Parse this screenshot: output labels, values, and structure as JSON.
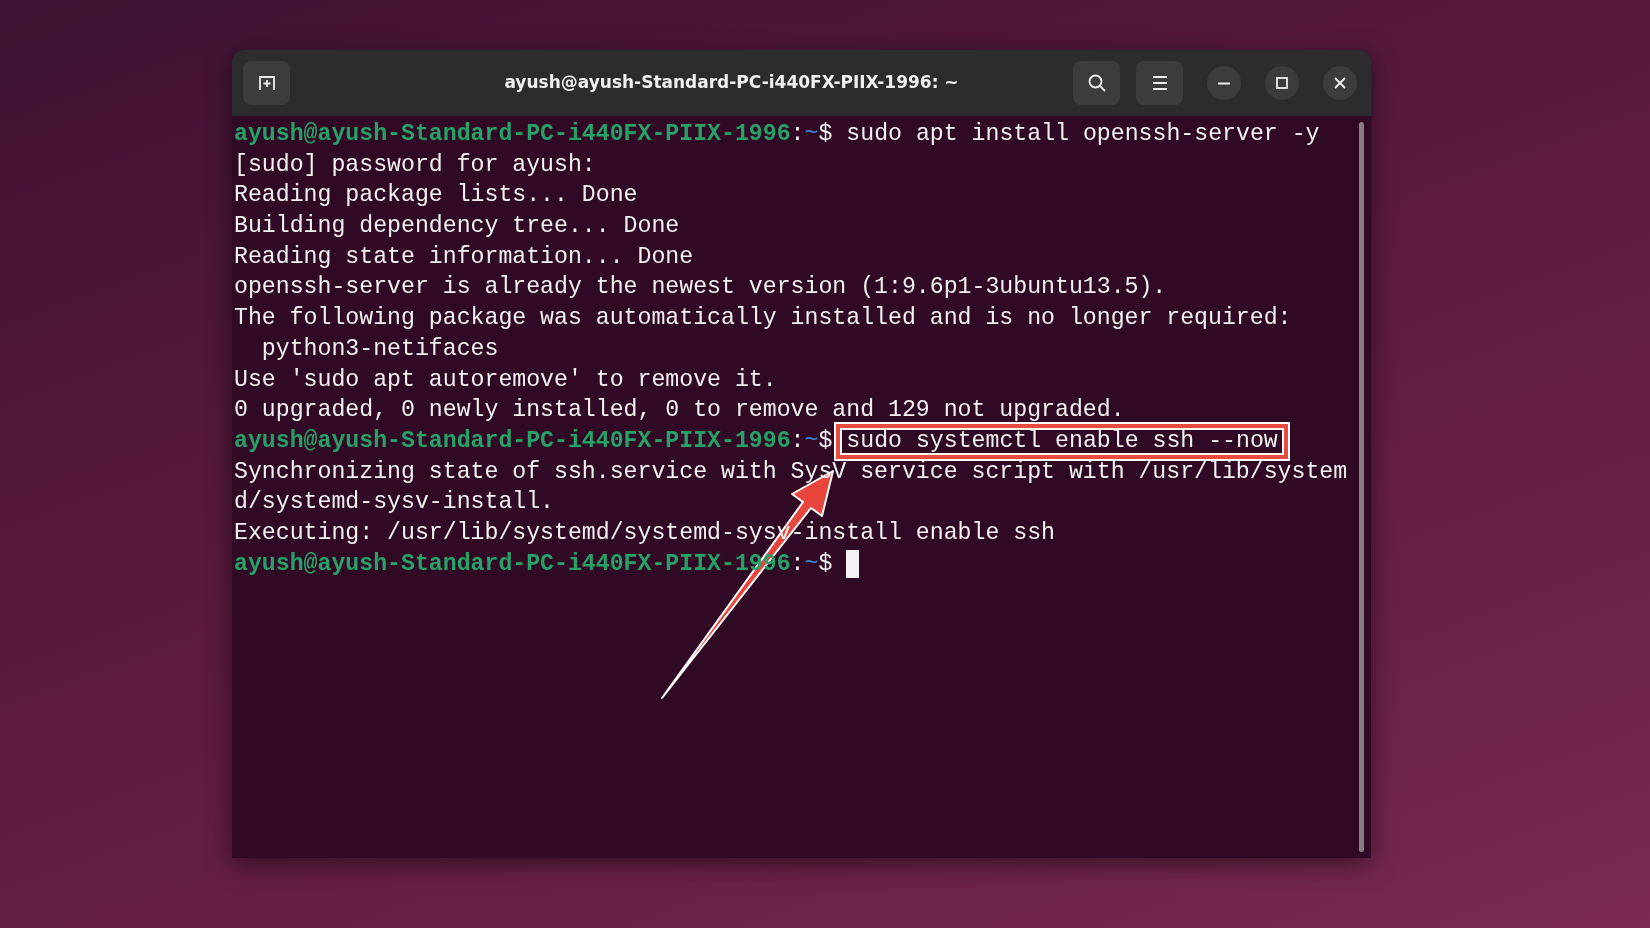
{
  "window": {
    "title": "ayush@ayush-Standard-PC-i440FX-PIIX-1996: ~"
  },
  "terminal": {
    "lines": [
      {
        "kind": "prompt",
        "user": "ayush@ayush-Standard-PC-i440FX-PIIX-1996",
        "separator": ":",
        "path": "~",
        "symbol": "$",
        "command": "sudo apt install openssh-server -y",
        "highlighted": false,
        "cursor": false
      },
      {
        "kind": "output",
        "text": "[sudo] password for ayush:"
      },
      {
        "kind": "output",
        "text": "Reading package lists... Done"
      },
      {
        "kind": "output",
        "text": "Building dependency tree... Done"
      },
      {
        "kind": "output",
        "text": "Reading state information... Done"
      },
      {
        "kind": "output",
        "text": "openssh-server is already the newest version (1:9.6p1-3ubuntu13.5)."
      },
      {
        "kind": "output",
        "text": "The following package was automatically installed and is no longer required:"
      },
      {
        "kind": "output",
        "text": "  python3-netifaces"
      },
      {
        "kind": "output",
        "text": "Use 'sudo apt autoremove' to remove it."
      },
      {
        "kind": "output",
        "text": "0 upgraded, 0 newly installed, 0 to remove and 129 not upgraded."
      },
      {
        "kind": "prompt",
        "user": "ayush@ayush-Standard-PC-i440FX-PIIX-1996",
        "separator": ":",
        "path": "~",
        "symbol": "$",
        "command": "sudo systemctl enable ssh --now",
        "highlighted": true,
        "cursor": false
      },
      {
        "kind": "output",
        "text": "Synchronizing state of ssh.service with SysV service script with /usr/lib/system"
      },
      {
        "kind": "output",
        "text": "d/systemd-sysv-install."
      },
      {
        "kind": "output",
        "text": "Executing: /usr/lib/systemd/systemd-sysv-install enable ssh"
      },
      {
        "kind": "prompt",
        "user": "ayush@ayush-Standard-PC-i440FX-PIIX-1996",
        "separator": ":",
        "path": "~",
        "symbol": "$",
        "highlighted": false,
        "cursor": true
      }
    ]
  },
  "annotation": {
    "kind": "arrow"
  }
}
